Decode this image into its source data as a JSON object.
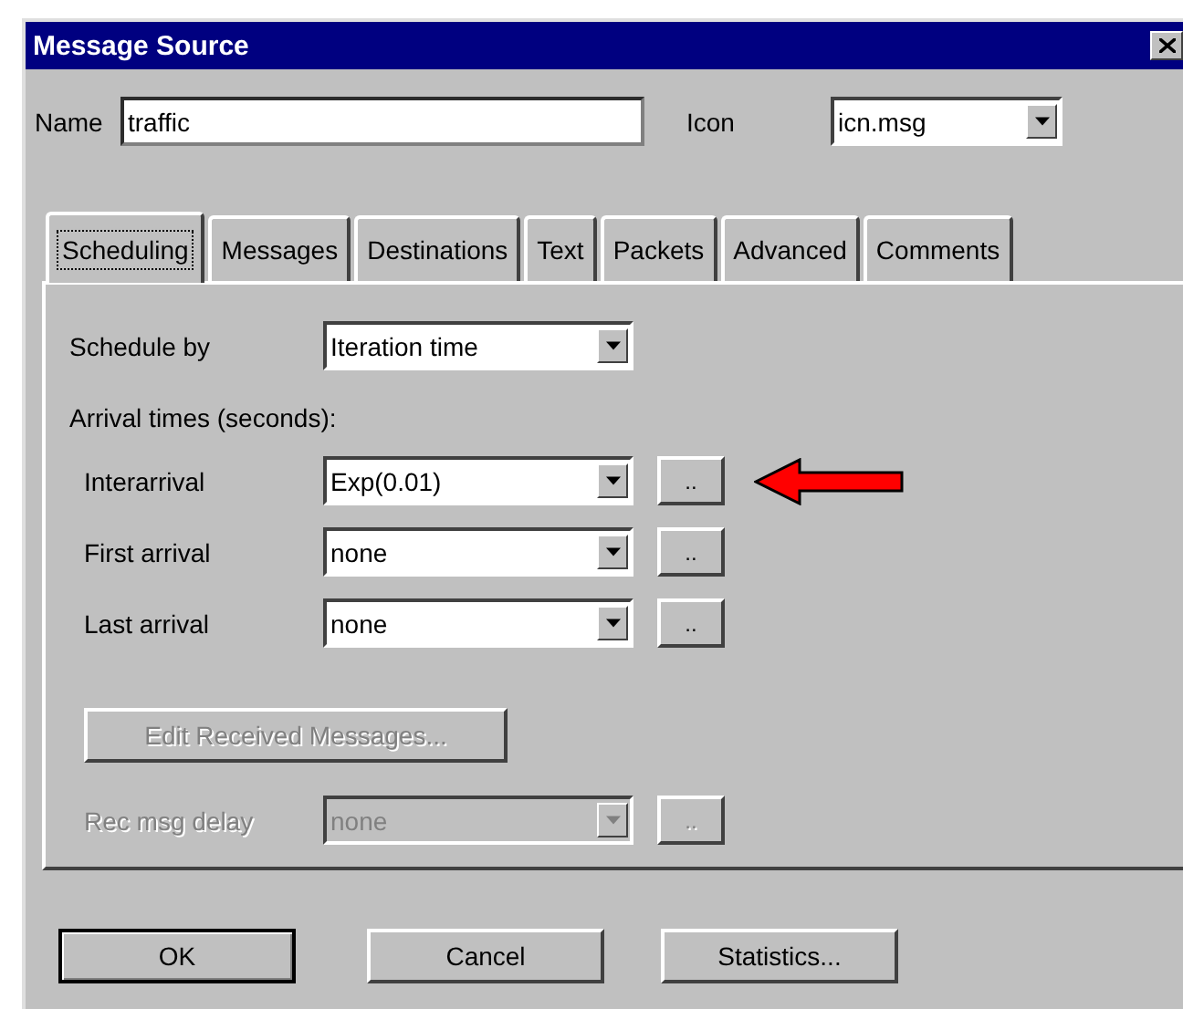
{
  "window": {
    "title": "Message Source"
  },
  "name_field": {
    "label": "Name",
    "value": "traffic"
  },
  "icon_field": {
    "label": "Icon",
    "value": "icn.msg"
  },
  "tabs": [
    {
      "label": "Scheduling",
      "selected": true
    },
    {
      "label": "Messages",
      "selected": false
    },
    {
      "label": "Destinations",
      "selected": false
    },
    {
      "label": "Text",
      "selected": false
    },
    {
      "label": "Packets",
      "selected": false
    },
    {
      "label": "Advanced",
      "selected": false
    },
    {
      "label": "Comments",
      "selected": false
    }
  ],
  "schedule_by": {
    "label": "Schedule by",
    "value": "Iteration time"
  },
  "arrival_heading": "Arrival times (seconds):",
  "arrival_rows": [
    {
      "label": "Interarrival",
      "value": "Exp(0.01)",
      "button": "..",
      "annotated": true
    },
    {
      "label": "First arrival",
      "value": "none",
      "button": "..",
      "annotated": false
    },
    {
      "label": "Last arrival",
      "value": "none",
      "button": "..",
      "annotated": false
    }
  ],
  "edit_button": {
    "label": "Edit Received Messages...",
    "disabled": true
  },
  "rec_delay": {
    "label": "Rec msg delay",
    "value": "none",
    "button": "..",
    "disabled": true
  },
  "buttons": [
    {
      "label": "OK",
      "default": true
    },
    {
      "label": "Cancel",
      "default": false
    },
    {
      "label": "Statistics...",
      "default": false
    }
  ]
}
